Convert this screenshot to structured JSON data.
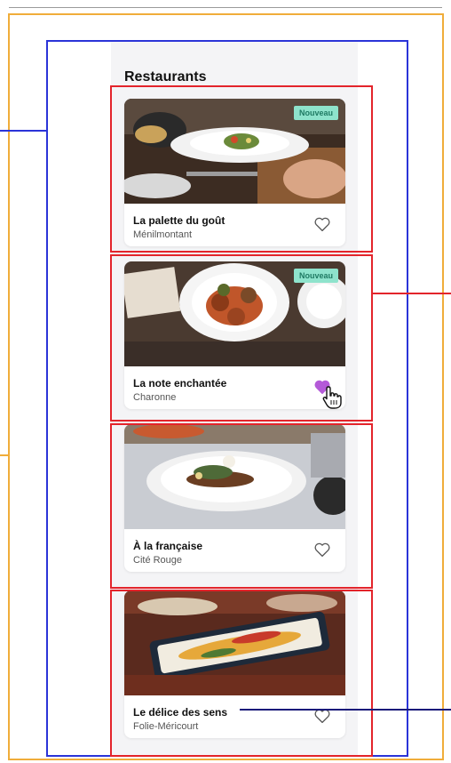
{
  "screen": {
    "title": "Restaurants"
  },
  "restaurants": [
    {
      "name": "La palette du goût",
      "area": "Ménilmontant",
      "badge": "Nouveau",
      "favorite": false,
      "photo_icon": "plated-dish-table-photo"
    },
    {
      "name": "La note enchantée",
      "area": "Charonne",
      "badge": "Nouveau",
      "favorite": true,
      "photo_icon": "meatballs-plate-photo"
    },
    {
      "name": "À la française",
      "area": "Cité Rouge",
      "badge": "",
      "favorite": false,
      "photo_icon": "grilled-fish-plate-photo"
    },
    {
      "name": "Le délice des sens",
      "area": "Folie-Méricourt",
      "badge": "",
      "favorite": false,
      "photo_icon": "skewers-platter-photo"
    }
  ],
  "icons": {
    "favorite": "heart-icon",
    "cursor": "hand-pointer-icon"
  },
  "colors": {
    "background_panel": "#f4f4f6",
    "badge_bg": "#8ee3cc",
    "badge_text": "#1f7a63",
    "heart_active": "#b45ad8",
    "annotation_orange": "#f0ad3a",
    "annotation_blue": "#2b34d8",
    "annotation_red": "#e3242b",
    "annotation_navy": "#1a1a7a"
  }
}
